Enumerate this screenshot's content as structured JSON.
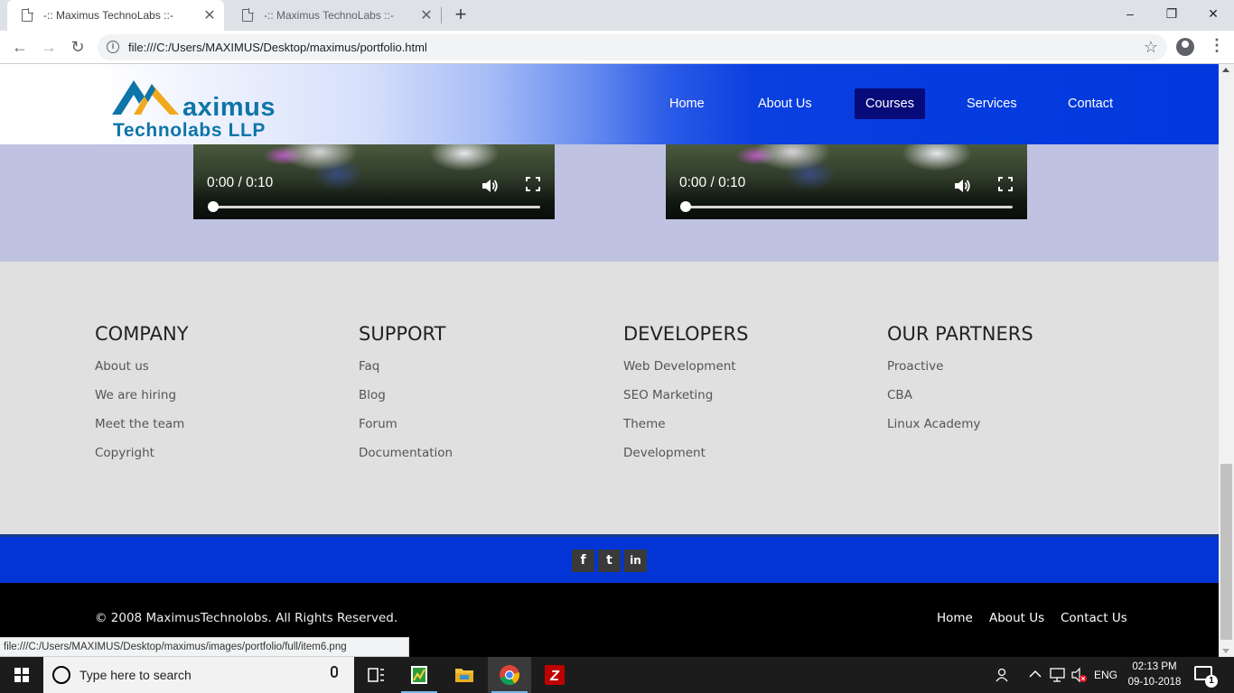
{
  "browser": {
    "tabs": [
      {
        "title": "-:: Maximus TechnoLabs ::-",
        "active": true
      },
      {
        "title": "-:: Maximus TechnoLabs ::-",
        "active": false
      }
    ],
    "new_tab_symbol": "+",
    "window_controls": {
      "minimize": "–",
      "restore": "❐",
      "close": "✕"
    },
    "nav": {
      "back": "←",
      "forward": "→",
      "reload": "↻"
    },
    "address": "file:///C:/Users/MAXIMUS/Desktop/maximus/portfolio.html",
    "info_icon": "i",
    "bookmark_icon": "☆",
    "menu_icon": "⋮",
    "status_url": "file:///C:/Users/MAXIMUS/Desktop/maximus/images/portfolio/full/item6.png"
  },
  "site": {
    "logo": {
      "line1": "aximus",
      "line2": "Technolabs LLP"
    },
    "nav": [
      {
        "label": "Home",
        "active": false
      },
      {
        "label": "About Us",
        "active": false
      },
      {
        "label": "Courses",
        "active": true
      },
      {
        "label": "Services",
        "active": false
      },
      {
        "label": "Contact",
        "active": false
      }
    ],
    "videos": [
      {
        "time": "0:00 / 0:10",
        "progress": 0
      },
      {
        "time": "0:00 / 0:10",
        "progress": 0
      }
    ],
    "footer_columns": [
      {
        "heading": "COMPANY",
        "links": [
          "About us",
          "We are hiring",
          "Meet the team",
          "Copyright"
        ]
      },
      {
        "heading": "SUPPORT",
        "links": [
          "Faq",
          "Blog",
          "Forum",
          "Documentation"
        ]
      },
      {
        "heading": "DEVELOPERS",
        "links": [
          "Web Development",
          "SEO Marketing",
          "Theme",
          "Development"
        ]
      },
      {
        "heading": "OUR PARTNERS",
        "links": [
          "Proactive",
          "CBA",
          "Linux Academy"
        ]
      }
    ],
    "social": {
      "facebook": "f",
      "twitter": "t",
      "linkedin": "in"
    },
    "copyright": "© 2008 MaximusTechnolobs. All Rights Reserved.",
    "bottom_links": [
      "Home",
      "About Us",
      "Contact Us"
    ],
    "colors": {
      "header_blue": "#0038de",
      "active_nav": "#070a79",
      "social_bar": "#0335d6",
      "logo_teal": "#0e75a8",
      "logo_gold": "#f0a91c"
    }
  },
  "taskbar": {
    "search_placeholder": "Type here to search",
    "language": "ENG",
    "time": "02:13 PM",
    "date": "09-10-2018",
    "notifications": "1",
    "pinned": [
      "task-view-icon",
      "spreadsheet-app-icon",
      "file-explorer-icon",
      "chrome-icon",
      "filezilla-icon"
    ]
  }
}
